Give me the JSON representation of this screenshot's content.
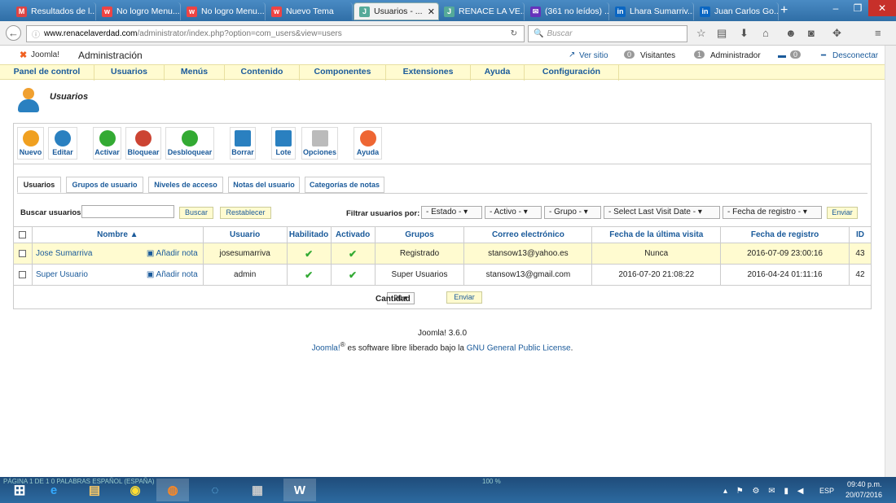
{
  "browser": {
    "tabs": [
      {
        "label": "Resultados de l...",
        "fav": "M",
        "color": "#d44"
      },
      {
        "label": "No logro Menu...",
        "fav": "w",
        "color": "#e44"
      },
      {
        "label": "No logro Menu...",
        "fav": "w",
        "color": "#e44"
      },
      {
        "label": "Nuevo Tema",
        "fav": "w",
        "color": "#e44"
      },
      {
        "label": "Usuarios - ...",
        "fav": "J",
        "color": "#5a9"
      },
      {
        "label": "RENACE LA VE...",
        "fav": "J",
        "color": "#5a9"
      },
      {
        "label": "(361 no leídos) ...",
        "fav": "✉",
        "color": "#63b"
      },
      {
        "label": "Lhara Sumarriv...",
        "fav": "in",
        "color": "#0a66c2"
      },
      {
        "label": "Juan Carlos Go...",
        "fav": "in",
        "color": "#0a66c2"
      }
    ],
    "url_host": "www.renacelaverdad.com",
    "url_path": "/administrator/index.php?option=com_users&view=users",
    "search_placeholder": "Buscar"
  },
  "admin": {
    "logo": "Joomla!",
    "title": "Administración",
    "ver_sitio": "Ver sitio",
    "visitantes_count": "0",
    "visitantes": "Visitantes",
    "admin_count": "1",
    "administrador": "Administrador",
    "msg_count": "0",
    "desconectar": "Desconectar"
  },
  "menu": [
    "Panel de control",
    "Usuarios",
    "Menús",
    "Contenido",
    "Componentes",
    "Extensiones",
    "Ayuda",
    "Configuración"
  ],
  "page_title": "Usuarios",
  "toolbar": [
    {
      "label": "Nuevo",
      "color": "#f0a020"
    },
    {
      "label": "Editar",
      "color": "#2a80c0"
    },
    {
      "label": "Activar",
      "color": "#3a3"
    },
    {
      "label": "Bloquear",
      "color": "#c43"
    },
    {
      "label": "Desbloquear",
      "color": "#3a3"
    },
    {
      "label": "Borrar",
      "color": "#2a80c0"
    },
    {
      "label": "Lote",
      "color": "#2a80c0"
    },
    {
      "label": "Opciones",
      "color": "#888"
    },
    {
      "label": "Ayuda",
      "color": "#e63"
    }
  ],
  "subtabs": [
    "Usuarios",
    "Grupos de usuario",
    "Niveles de acceso",
    "Notas del usuario",
    "Categorías de notas"
  ],
  "filters": {
    "search_label": "Buscar usuarios",
    "buscar": "Buscar",
    "restablecer": "Restablecer",
    "filter_label": "Filtrar usuarios por:",
    "estado": "- Estado -",
    "activo": "- Activo -",
    "grupo": "- Grupo -",
    "last_visit": "- Select Last Visit Date -",
    "fecha_registro": "- Fecha de registro -",
    "enviar": "Enviar"
  },
  "table": {
    "headers": [
      "Nombre ▲",
      "Usuario",
      "Habilitado",
      "Activado",
      "Grupos",
      "Correo electrónico",
      "Fecha de la última visita",
      "Fecha de registro",
      "ID"
    ],
    "add_note": "Añadir nota",
    "rows": [
      {
        "nombre": "Jose Sumarriva",
        "usuario": "josesumarriva",
        "habilitado": "✔",
        "activado": "✔",
        "grupos": "Registrado",
        "correo": "stansow13@yahoo.es",
        "ultima": "Nunca",
        "registro": "2016-07-09 23:00:16",
        "id": "43"
      },
      {
        "nombre": "Super Usuario",
        "usuario": "admin",
        "habilitado": "✔",
        "activado": "✔",
        "grupos": "Super Usuarios",
        "correo": "stansow13@gmail.com",
        "ultima": "2016-07-20 21:08:22",
        "registro": "2016-04-24 01:11:16",
        "id": "42"
      }
    ],
    "cantidad_label": "Cantidad",
    "cantidad": "20",
    "enviar": "Enviar"
  },
  "footer": {
    "version": "Joomla! 3.6.0",
    "joomla": "Joomla!",
    "reg": "®",
    "text": " es software libre liberado bajo la ",
    "license": "GNU General Public License",
    "dot": "."
  },
  "taskbar": {
    "status": "PÁGINA 1 DE 1    0 PALABRAS    ESPAÑOL (ESPAÑA)",
    "zoom": "100 %",
    "lang": "ESP",
    "time": "09:40 p.m.",
    "date": "20/07/2016"
  }
}
